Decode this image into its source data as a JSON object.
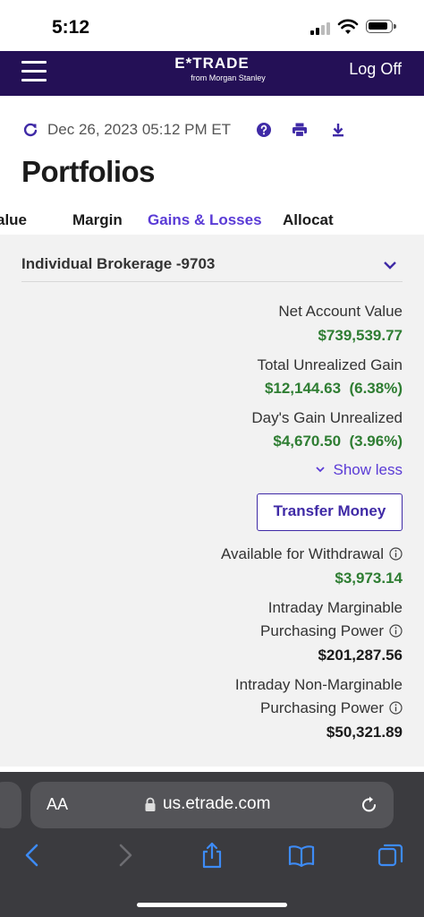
{
  "status_bar": {
    "time": "5:12"
  },
  "header": {
    "logo_main": "E*TRADE",
    "logo_sub": "from Morgan Stanley",
    "logoff_label": "Log Off"
  },
  "toolbar": {
    "as_of": "Dec 26, 2023 05:12 PM ET"
  },
  "page_title": "Portfolios",
  "tabs": [
    {
      "label": "alue",
      "active": false
    },
    {
      "label": "Margin",
      "active": false
    },
    {
      "label": "Gains & Losses",
      "active": true
    },
    {
      "label": "Allocat",
      "active": false
    }
  ],
  "account": {
    "name": "Individual Brokerage -9703"
  },
  "summary": {
    "net_account_value_label": "Net Account Value",
    "net_account_value": "$739,539.77",
    "total_unrealized_label": "Total Unrealized Gain",
    "total_unrealized": "$12,144.63  (6.38%)",
    "days_gain_label": "Day's Gain Unrealized",
    "days_gain": "$4,670.50  (3.96%)",
    "show_less_label": "Show less",
    "transfer_label": "Transfer Money",
    "available_label": "Available for Withdrawal",
    "available_value": "$3,973.14",
    "intraday_marg_label_1": "Intraday Marginable",
    "intraday_marg_label_2": "Purchasing Power",
    "intraday_marg_value": "$201,287.56",
    "intraday_nonmarg_label_1": "Intraday Non-Marginable",
    "intraday_nonmarg_label_2": "Purchasing Power",
    "intraday_nonmarg_value": "$50,321.89"
  },
  "safari": {
    "text_size_label": "AA",
    "url": "us.etrade.com"
  },
  "colors": {
    "header_bg": "#241056",
    "accent": "#5a3bd6",
    "gain_green": "#2e7d32",
    "content_bg": "#f2f2f2"
  }
}
